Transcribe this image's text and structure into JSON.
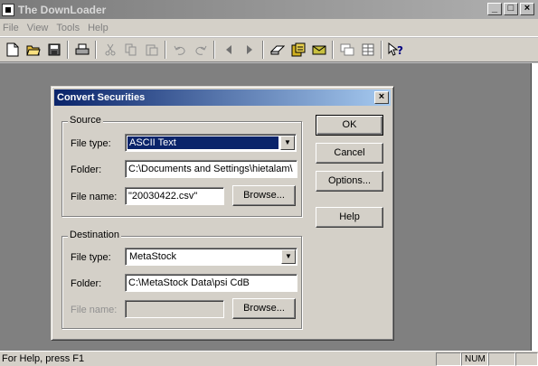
{
  "window": {
    "title": "The DownLoader",
    "minimize": "_",
    "maximize": "□",
    "close": "×"
  },
  "menu": [
    "File",
    "View",
    "Tools",
    "Help"
  ],
  "toolbar": {
    "icons": [
      "new-file-icon",
      "open-folder-icon",
      "save-icon",
      "print-icon",
      "cut-icon",
      "copy-icon",
      "paste-icon",
      "undo-icon",
      "redo-icon",
      "back-icon",
      "forward-icon",
      "eraser-icon",
      "convert-icon",
      "mail-icon",
      "window-icon",
      "grid-icon",
      "help-pointer-icon"
    ]
  },
  "status": {
    "help_text": "For Help, press F1",
    "num": "NUM"
  },
  "dialog": {
    "title": "Convert Securities",
    "close": "×",
    "source": {
      "group_label": "Source",
      "file_type_label": "File type:",
      "file_type_value": "ASCII Text",
      "folder_label": "Folder:",
      "folder_value": "C:\\Documents and Settings\\hietalam\\",
      "file_name_label": "File name:",
      "file_name_value": "\"20030422.csv\"",
      "browse_label": "Browse..."
    },
    "destination": {
      "group_label": "Destination",
      "file_type_label": "File type:",
      "file_type_value": "MetaStock",
      "folder_label": "Folder:",
      "folder_value": "C:\\MetaStock Data\\psi CdB",
      "file_name_label": "File name:",
      "file_name_value": "",
      "browse_label": "Browse..."
    },
    "buttons": {
      "ok": "OK",
      "cancel": "Cancel",
      "options": "Options...",
      "help": "Help"
    }
  }
}
